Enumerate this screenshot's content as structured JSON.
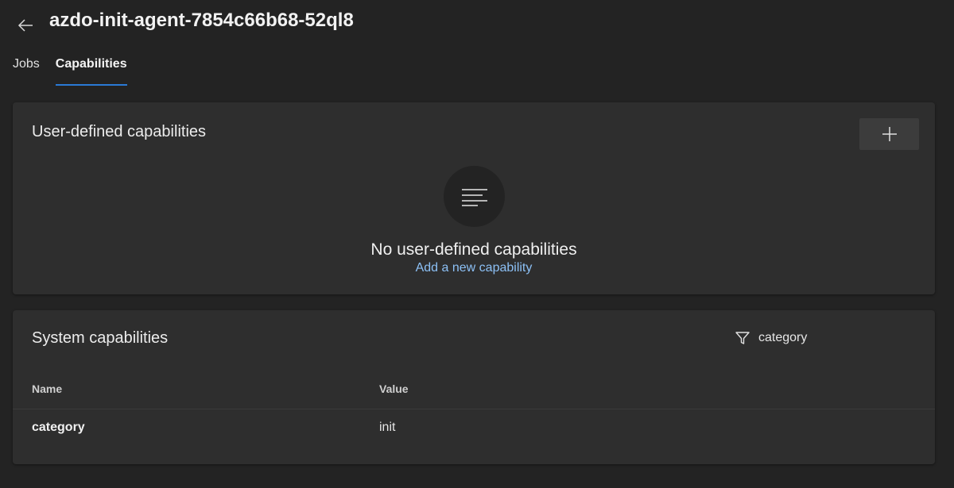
{
  "header": {
    "title": "azdo-init-agent-7854c66b68-52ql8",
    "back_icon": "arrow-left-icon"
  },
  "tabs": [
    {
      "label": "Jobs",
      "selected": false
    },
    {
      "label": "Capabilities",
      "selected": true
    }
  ],
  "user_capabilities": {
    "title": "User-defined capabilities",
    "add_icon": "plus-icon",
    "empty_icon": "list-lines-icon",
    "empty_title": "No user-defined capabilities",
    "empty_link": "Add a new capability"
  },
  "system_capabilities": {
    "title": "System capabilities",
    "filter_icon": "funnel-icon",
    "filter_text": "category",
    "columns": [
      "Name",
      "Value"
    ],
    "rows": [
      {
        "name": "category",
        "value": "init"
      }
    ]
  },
  "colors": {
    "background": "#232323",
    "card": "#2e2e2e",
    "accent": "#2a7ad6",
    "link": "#8cc0f5"
  }
}
